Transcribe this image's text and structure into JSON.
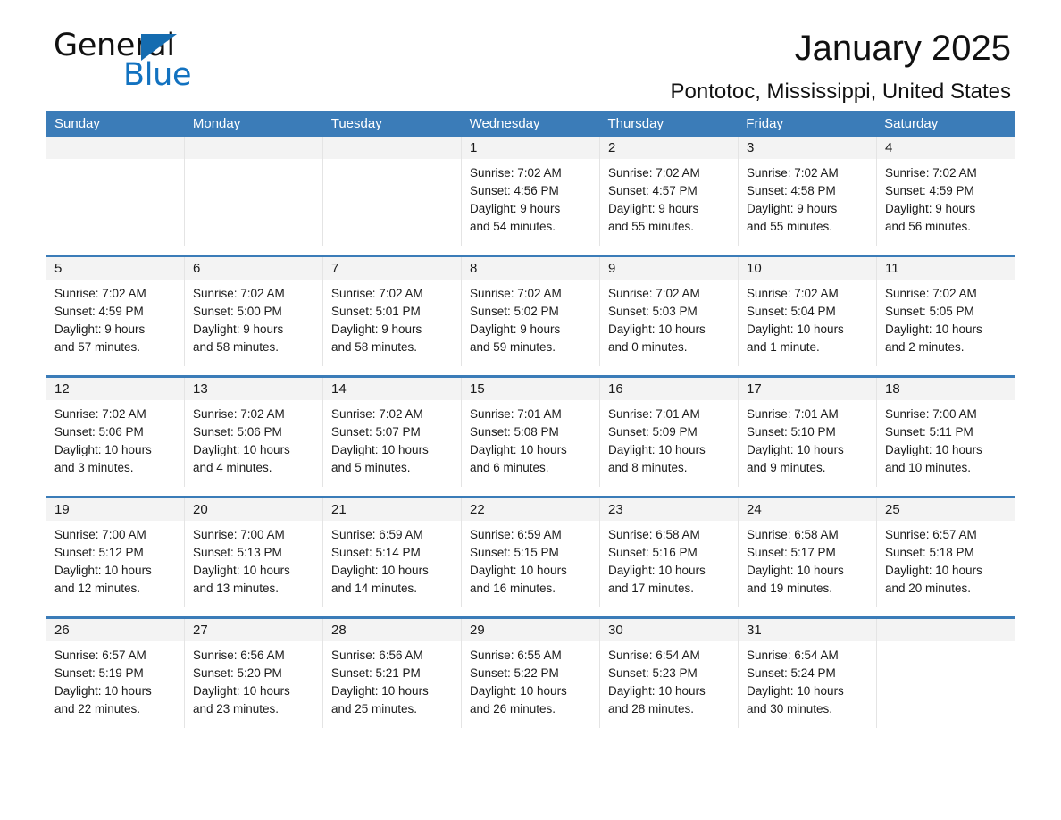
{
  "brand": {
    "word_one": "General",
    "word_two": "Blue",
    "flag_icon": "triangle-flag-icon"
  },
  "header": {
    "title": "January 2025",
    "subtitle": "Pontotoc, Mississippi, United States"
  },
  "colors": {
    "header_blue": "#3b7cb8",
    "brand_blue": "#1272c0",
    "daynum_band": "#f3f3f3",
    "cell_border": "#e4e4e4"
  },
  "weekdays": [
    "Sunday",
    "Monday",
    "Tuesday",
    "Wednesday",
    "Thursday",
    "Friday",
    "Saturday"
  ],
  "weeks": [
    [
      {
        "day": "",
        "lines": []
      },
      {
        "day": "",
        "lines": []
      },
      {
        "day": "",
        "lines": []
      },
      {
        "day": "1",
        "lines": [
          "Sunrise: 7:02 AM",
          "Sunset: 4:56 PM",
          "Daylight: 9 hours",
          "and 54 minutes."
        ]
      },
      {
        "day": "2",
        "lines": [
          "Sunrise: 7:02 AM",
          "Sunset: 4:57 PM",
          "Daylight: 9 hours",
          "and 55 minutes."
        ]
      },
      {
        "day": "3",
        "lines": [
          "Sunrise: 7:02 AM",
          "Sunset: 4:58 PM",
          "Daylight: 9 hours",
          "and 55 minutes."
        ]
      },
      {
        "day": "4",
        "lines": [
          "Sunrise: 7:02 AM",
          "Sunset: 4:59 PM",
          "Daylight: 9 hours",
          "and 56 minutes."
        ]
      }
    ],
    [
      {
        "day": "5",
        "lines": [
          "Sunrise: 7:02 AM",
          "Sunset: 4:59 PM",
          "Daylight: 9 hours",
          "and 57 minutes."
        ]
      },
      {
        "day": "6",
        "lines": [
          "Sunrise: 7:02 AM",
          "Sunset: 5:00 PM",
          "Daylight: 9 hours",
          "and 58 minutes."
        ]
      },
      {
        "day": "7",
        "lines": [
          "Sunrise: 7:02 AM",
          "Sunset: 5:01 PM",
          "Daylight: 9 hours",
          "and 58 minutes."
        ]
      },
      {
        "day": "8",
        "lines": [
          "Sunrise: 7:02 AM",
          "Sunset: 5:02 PM",
          "Daylight: 9 hours",
          "and 59 minutes."
        ]
      },
      {
        "day": "9",
        "lines": [
          "Sunrise: 7:02 AM",
          "Sunset: 5:03 PM",
          "Daylight: 10 hours",
          "and 0 minutes."
        ]
      },
      {
        "day": "10",
        "lines": [
          "Sunrise: 7:02 AM",
          "Sunset: 5:04 PM",
          "Daylight: 10 hours",
          "and 1 minute."
        ]
      },
      {
        "day": "11",
        "lines": [
          "Sunrise: 7:02 AM",
          "Sunset: 5:05 PM",
          "Daylight: 10 hours",
          "and 2 minutes."
        ]
      }
    ],
    [
      {
        "day": "12",
        "lines": [
          "Sunrise: 7:02 AM",
          "Sunset: 5:06 PM",
          "Daylight: 10 hours",
          "and 3 minutes."
        ]
      },
      {
        "day": "13",
        "lines": [
          "Sunrise: 7:02 AM",
          "Sunset: 5:06 PM",
          "Daylight: 10 hours",
          "and 4 minutes."
        ]
      },
      {
        "day": "14",
        "lines": [
          "Sunrise: 7:02 AM",
          "Sunset: 5:07 PM",
          "Daylight: 10 hours",
          "and 5 minutes."
        ]
      },
      {
        "day": "15",
        "lines": [
          "Sunrise: 7:01 AM",
          "Sunset: 5:08 PM",
          "Daylight: 10 hours",
          "and 6 minutes."
        ]
      },
      {
        "day": "16",
        "lines": [
          "Sunrise: 7:01 AM",
          "Sunset: 5:09 PM",
          "Daylight: 10 hours",
          "and 8 minutes."
        ]
      },
      {
        "day": "17",
        "lines": [
          "Sunrise: 7:01 AM",
          "Sunset: 5:10 PM",
          "Daylight: 10 hours",
          "and 9 minutes."
        ]
      },
      {
        "day": "18",
        "lines": [
          "Sunrise: 7:00 AM",
          "Sunset: 5:11 PM",
          "Daylight: 10 hours",
          "and 10 minutes."
        ]
      }
    ],
    [
      {
        "day": "19",
        "lines": [
          "Sunrise: 7:00 AM",
          "Sunset: 5:12 PM",
          "Daylight: 10 hours",
          "and 12 minutes."
        ]
      },
      {
        "day": "20",
        "lines": [
          "Sunrise: 7:00 AM",
          "Sunset: 5:13 PM",
          "Daylight: 10 hours",
          "and 13 minutes."
        ]
      },
      {
        "day": "21",
        "lines": [
          "Sunrise: 6:59 AM",
          "Sunset: 5:14 PM",
          "Daylight: 10 hours",
          "and 14 minutes."
        ]
      },
      {
        "day": "22",
        "lines": [
          "Sunrise: 6:59 AM",
          "Sunset: 5:15 PM",
          "Daylight: 10 hours",
          "and 16 minutes."
        ]
      },
      {
        "day": "23",
        "lines": [
          "Sunrise: 6:58 AM",
          "Sunset: 5:16 PM",
          "Daylight: 10 hours",
          "and 17 minutes."
        ]
      },
      {
        "day": "24",
        "lines": [
          "Sunrise: 6:58 AM",
          "Sunset: 5:17 PM",
          "Daylight: 10 hours",
          "and 19 minutes."
        ]
      },
      {
        "day": "25",
        "lines": [
          "Sunrise: 6:57 AM",
          "Sunset: 5:18 PM",
          "Daylight: 10 hours",
          "and 20 minutes."
        ]
      }
    ],
    [
      {
        "day": "26",
        "lines": [
          "Sunrise: 6:57 AM",
          "Sunset: 5:19 PM",
          "Daylight: 10 hours",
          "and 22 minutes."
        ]
      },
      {
        "day": "27",
        "lines": [
          "Sunrise: 6:56 AM",
          "Sunset: 5:20 PM",
          "Daylight: 10 hours",
          "and 23 minutes."
        ]
      },
      {
        "day": "28",
        "lines": [
          "Sunrise: 6:56 AM",
          "Sunset: 5:21 PM",
          "Daylight: 10 hours",
          "and 25 minutes."
        ]
      },
      {
        "day": "29",
        "lines": [
          "Sunrise: 6:55 AM",
          "Sunset: 5:22 PM",
          "Daylight: 10 hours",
          "and 26 minutes."
        ]
      },
      {
        "day": "30",
        "lines": [
          "Sunrise: 6:54 AM",
          "Sunset: 5:23 PM",
          "Daylight: 10 hours",
          "and 28 minutes."
        ]
      },
      {
        "day": "31",
        "lines": [
          "Sunrise: 6:54 AM",
          "Sunset: 5:24 PM",
          "Daylight: 10 hours",
          "and 30 minutes."
        ]
      },
      {
        "day": "",
        "lines": []
      }
    ]
  ]
}
